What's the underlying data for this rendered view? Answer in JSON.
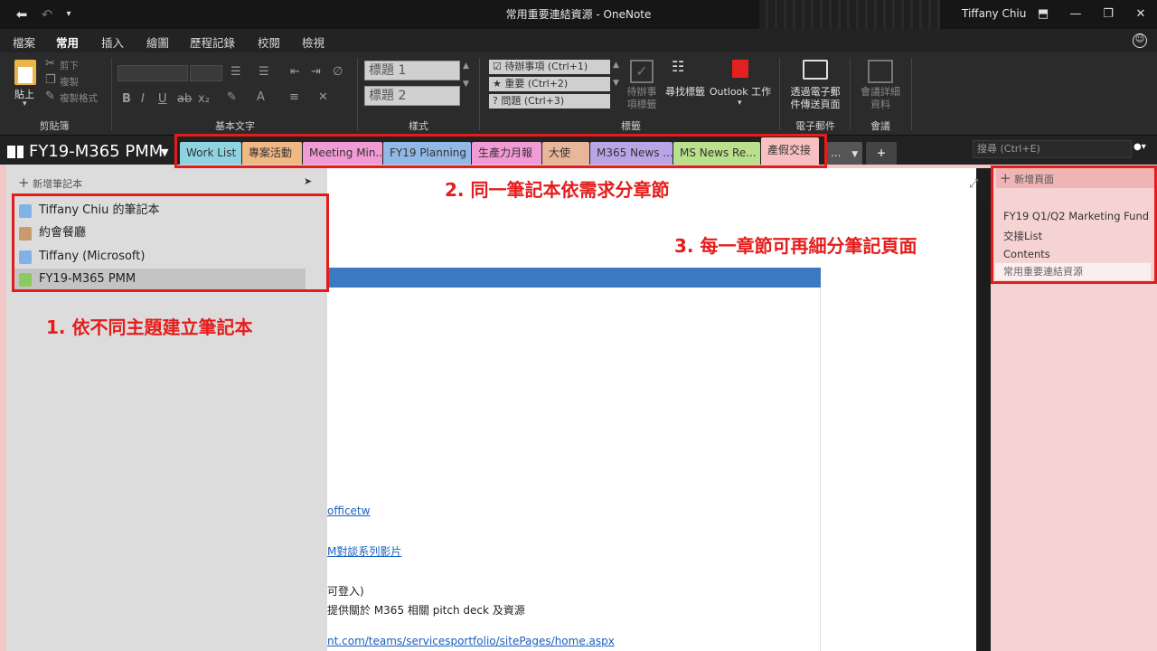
{
  "window": {
    "title": "常用重要連結資源 - OneNote",
    "user": "Tiffany Chiu"
  },
  "menu": {
    "tabs": [
      "檔案",
      "常用",
      "插入",
      "繪圖",
      "歷程記錄",
      "校閱",
      "檢視"
    ],
    "active": "常用"
  },
  "ribbon": {
    "clipboard": {
      "paste": "貼上",
      "cut": "剪下",
      "copy": "複製",
      "format_painter": "複製格式",
      "label": "剪貼簿"
    },
    "basic_text": {
      "label": "基本文字"
    },
    "styles": {
      "heading1": "標題 1",
      "heading2": "標題 2",
      "label": "樣式"
    },
    "tags": {
      "items": [
        "待辦事項 (Ctrl+1)",
        "重要 (Ctrl+2)",
        "問題 (Ctrl+3)"
      ],
      "todo_tag_line1": "待辦事",
      "todo_tag_line2": "項標籤",
      "find_tags": "尋找標籤",
      "outlook": "Outlook 工作",
      "label": "標籤"
    },
    "email": {
      "send_line1": "透過電子郵",
      "send_line2": "件傳送頁面",
      "label": "電子郵件"
    },
    "meetings": {
      "details_line1": "會議詳細",
      "details_line2": "資料",
      "label": "會議"
    }
  },
  "notebook_bar": {
    "current": "FY19-M365 PMM",
    "search_placeholder": "搜尋 (Ctrl+E)",
    "sections": [
      {
        "label": "Work List",
        "color": "#8fd3e0"
      },
      {
        "label": "專案活動",
        "color": "#f2b884"
      },
      {
        "label": "Meeting Min...",
        "color": "#f29ad5"
      },
      {
        "label": "FY19 Planning",
        "color": "#91b9e8"
      },
      {
        "label": "生產力月報",
        "color": "#f29ad5"
      },
      {
        "label": "大使",
        "color": "#e7b797"
      },
      {
        "label": "M365 News ...",
        "color": "#b9a5e6"
      },
      {
        "label": "MS News Re...",
        "color": "#b9e08a"
      },
      {
        "label": "產假交接",
        "color": "#f8c0c0"
      }
    ],
    "more": "...",
    "add": "+"
  },
  "notebooks": {
    "add_label": "新增筆記本",
    "items": [
      {
        "name": "Tiffany Chiu 的筆記本",
        "color": "#7fb3e8"
      },
      {
        "name": "約會餐廳",
        "color": "#c99a6d"
      },
      {
        "name": "Tiffany (Microsoft)",
        "color": "#7fb3e8"
      },
      {
        "name": "FY19-M365 PMM",
        "color": "#8cc95e"
      }
    ]
  },
  "pages": {
    "add_label": "新增頁面",
    "items": [
      "FY19 Q1/Q2 Marketing Fund",
      "交接List",
      "Contents"
    ],
    "selected": "常用重要連結資源"
  },
  "content": {
    "line1": "officetw",
    "line2": "M對談系列影片",
    "line3": "可登入)",
    "line4": "提供關於 M365 相關 pitch deck 及資源",
    "line5": "nt.com/teams/servicesportfolio/sitePages/home.aspx"
  },
  "annotations": {
    "a1": "1. 依不同主題建立筆記本",
    "a2": "2. 同一筆記本依需求分章節",
    "a3": "3. 每一章節可再細分筆記頁面"
  }
}
